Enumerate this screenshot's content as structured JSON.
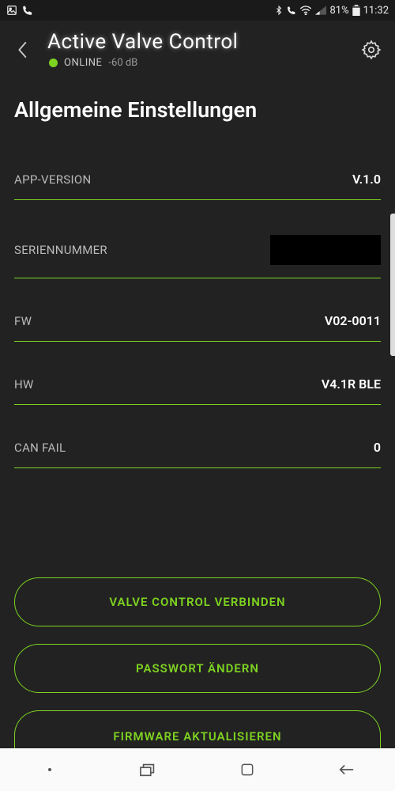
{
  "statusbar": {
    "battery": "81%",
    "time": "11:32"
  },
  "header": {
    "title": "Active Valve Control",
    "online_label": "ONLINE",
    "signal": "-60 dB"
  },
  "section": {
    "title": "Allgemeine Einstellungen"
  },
  "rows": {
    "app_version": {
      "label": "APP-VERSION",
      "value": "V.1.0"
    },
    "serial": {
      "label": "SERIENNUMMER",
      "value": ""
    },
    "fw": {
      "label": "FW",
      "value": "V02-0011"
    },
    "hw": {
      "label": "HW",
      "value": "V4.1R BLE"
    },
    "can_fail": {
      "label": "CAN FAIL",
      "value": "0"
    }
  },
  "buttons": {
    "connect": "VALVE CONTROL VERBINDEN",
    "password": "PASSWORT ÄNDERN",
    "firmware": "FIRMWARE AKTUALISIEREN"
  }
}
